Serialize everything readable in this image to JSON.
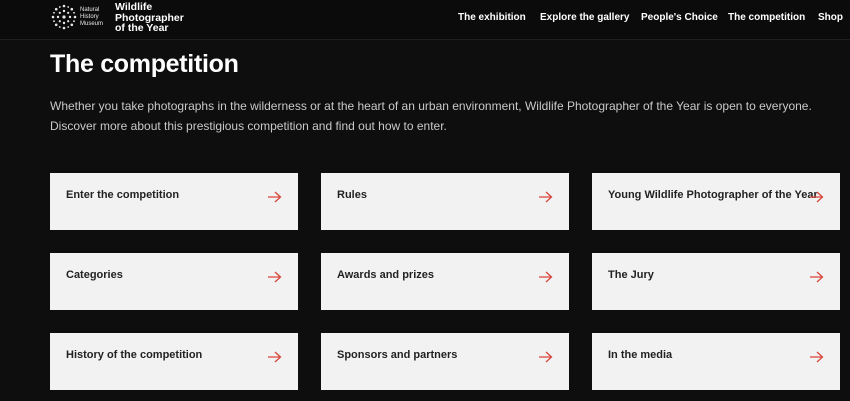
{
  "header": {
    "brand_lines": [
      "Natural",
      "History",
      "Museum"
    ],
    "title_lines": [
      "Wildlife",
      "Photographer",
      "of the Year"
    ],
    "nav": [
      "The exhibition",
      "Explore the gallery",
      "People's Choice",
      "The competition",
      "Shop"
    ]
  },
  "main": {
    "title": "The competition",
    "intro": "Whether you take photographs in the wilderness or at the heart of an urban environment, Wildlife Photographer of the Year is open to everyone. Discover more about this prestigious competition and find out how to enter.",
    "cards": [
      "Enter the competition",
      "Rules",
      "Young Wildlife Photographer of the Year",
      "Categories",
      "Awards and prizes",
      "The Jury",
      "History of the competition",
      "Sponsors and partners",
      "In the media"
    ]
  },
  "colors": {
    "background": "#0f0e0e",
    "card": "#f2f2f2",
    "arrow": "#d9463b"
  },
  "icons": [
    "nhm-logo-icon",
    "arrow-right-icon"
  ]
}
